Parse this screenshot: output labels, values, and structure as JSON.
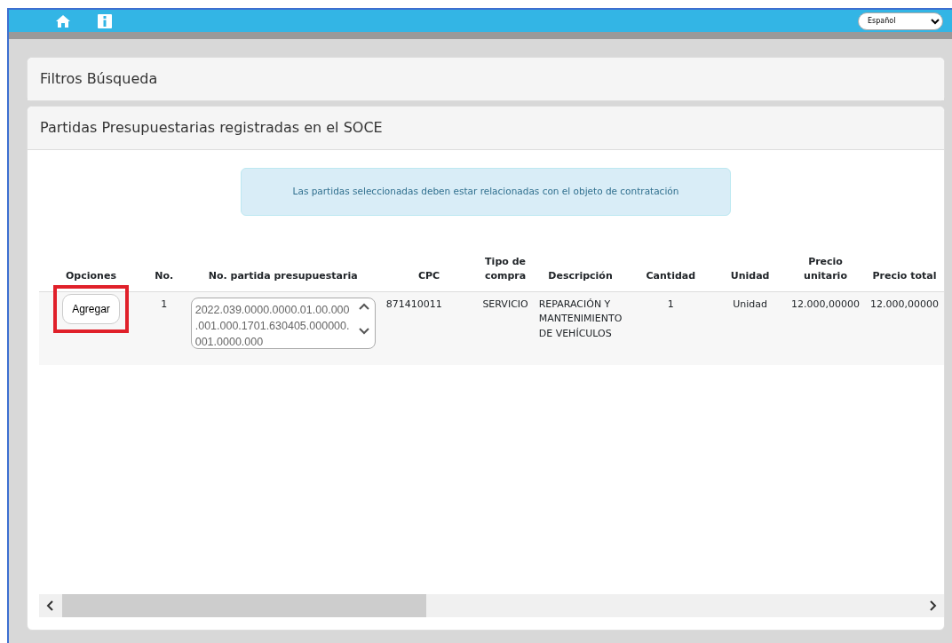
{
  "topbar": {
    "language": "Español"
  },
  "panels": [
    {
      "title": "Filtros Búsqueda"
    },
    {
      "title": "Partidas Presupuestarias registradas en el SOCE"
    }
  ],
  "alert": "Las partidas seleccionadas deben estar relacionadas con el objeto de contratación",
  "table": {
    "columns": [
      "Opciones",
      "No.",
      "No. partida presupuestaria",
      "CPC",
      "Tipo de compra",
      "Descripción",
      "Cantidad",
      "Unidad",
      "Precio unitario",
      "Precio total"
    ],
    "rows": [
      {
        "action": "Agregar",
        "highlighted": true,
        "no": "1",
        "partida": "2022.039.0000.0000.01.00.000.001.000.1701.630405.000000.001.0000.000",
        "cpc": "871410011",
        "tipo": "SERVICIO",
        "descripcion": "REPARACIÓN Y MANTENIMIENTO DE VEHÍCULOS",
        "cantidad": "1",
        "unidad": "Unidad",
        "precio_unitario": "12.000,00000",
        "precio_total": "12.000,00000"
      }
    ]
  }
}
